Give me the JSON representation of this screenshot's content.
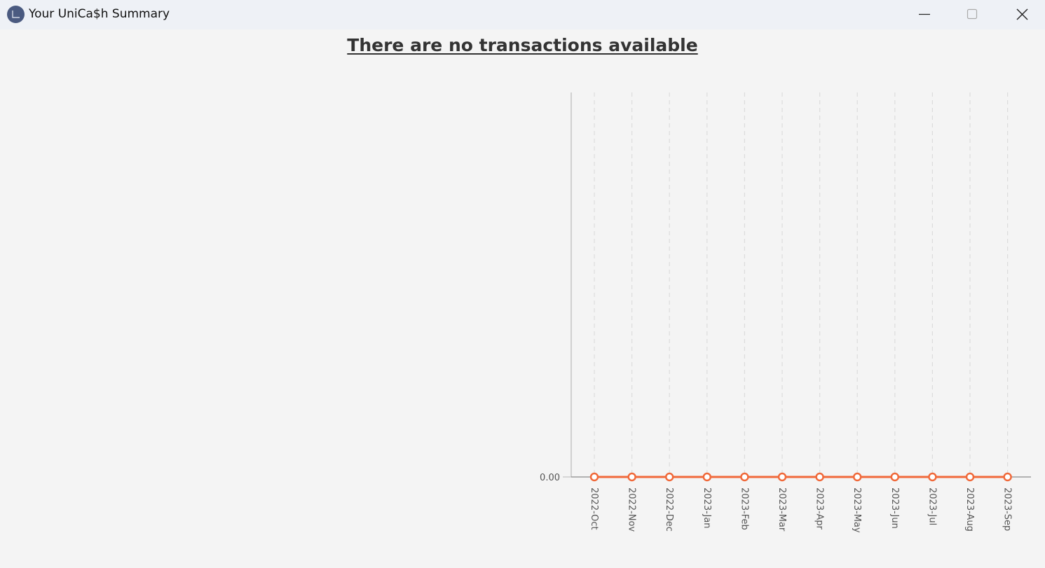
{
  "window": {
    "title": "Your UniCa$h Summary",
    "icon": "chart-icon",
    "controls": [
      "minimize-icon",
      "maximize-icon",
      "close-icon"
    ]
  },
  "main": {
    "headline": "There are no transactions available"
  },
  "colors": {
    "line": "#f0693a",
    "titlebar": "#eef1f6",
    "background": "#f4f4f4",
    "icon": "#4a5a80"
  },
  "chart_data": {
    "type": "line",
    "title": "",
    "xlabel": "",
    "ylabel": "",
    "categories": [
      "2022-Oct",
      "2022-Nov",
      "2022-Dec",
      "2023-Jan",
      "2023-Feb",
      "2023-Mar",
      "2023-Apr",
      "2023-May",
      "2023-Jun",
      "2023-Jul",
      "2023-Aug",
      "2023-Sep"
    ],
    "series": [
      {
        "values": [
          0,
          0,
          0,
          0,
          0,
          0,
          0,
          0,
          0,
          0,
          0,
          0
        ]
      }
    ],
    "y_tick_labels": [
      "0.00"
    ],
    "grid": "vertical dashed",
    "legend": "none"
  }
}
